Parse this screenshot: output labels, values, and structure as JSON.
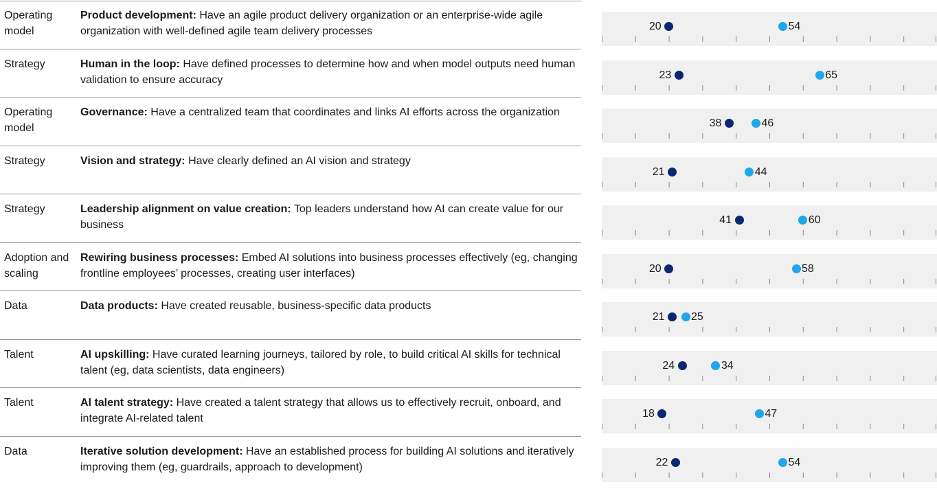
{
  "colors": {
    "before": "#0b2770",
    "after": "#1ea7ea"
  },
  "chart_data": {
    "type": "scatter",
    "xlim": [
      0,
      100
    ],
    "series": [
      {
        "name": "",
        "values": [
          20,
          23,
          38,
          21,
          41,
          20,
          21,
          24,
          18,
          22
        ]
      },
      {
        "name": "",
        "values": [
          54,
          65,
          46,
          44,
          60,
          58,
          25,
          34,
          47,
          54
        ]
      }
    ],
    "rows": [
      {
        "category": "Operating model",
        "title": "Product development:",
        "text": " Have an agile product delivery organization or an enterprise-wide agile organization with well-defined agile team delivery processes",
        "low": 20,
        "high": 54
      },
      {
        "category": "Strategy",
        "title": "Human in the loop:",
        "text": " Have defined processes to determine how and when model outputs need human validation to ensure accuracy",
        "low": 23,
        "high": 65
      },
      {
        "category": "Operating model",
        "title": "Governance:",
        "text": " Have a centralized team that coordinates and links AI efforts across the organization",
        "low": 38,
        "high": 46
      },
      {
        "category": "Strategy",
        "title": "Vision and strategy:",
        "text": " Have clearly defined an AI vision and strategy",
        "low": 21,
        "high": 44
      },
      {
        "category": "Strategy",
        "title": "Leadership alignment on value creation:",
        "text": " Top leaders understand how AI can create value for our business",
        "low": 41,
        "high": 60
      },
      {
        "category": "Adoption and scaling",
        "title": "Rewiring business processes:",
        "text": " Embed AI solutions into business processes effectively (eg, changing frontline employees’ processes, creating user interfaces)",
        "low": 20,
        "high": 58
      },
      {
        "category": "Data",
        "title": "Data products:",
        "text": " Have created reusable, business-specific data products",
        "low": 21,
        "high": 25
      },
      {
        "category": "Talent",
        "title": "AI upskilling:",
        "text": " Have curated learning journeys, tailored by role, to build critical AI skills for technical talent (eg, data scientists, data engineers)",
        "low": 24,
        "high": 34
      },
      {
        "category": "Talent",
        "title": "AI talent strategy:",
        "text": " Have created a talent strategy that allows us to effectively recruit, onboard, and integrate AI-related talent",
        "low": 18,
        "high": 47
      },
      {
        "category": "Data",
        "title": "Iterative solution development:",
        "text": " Have an established process for building AI solutions and iteratively improving them (eg, guardrails, approach to development)",
        "low": 22,
        "high": 54
      }
    ]
  }
}
